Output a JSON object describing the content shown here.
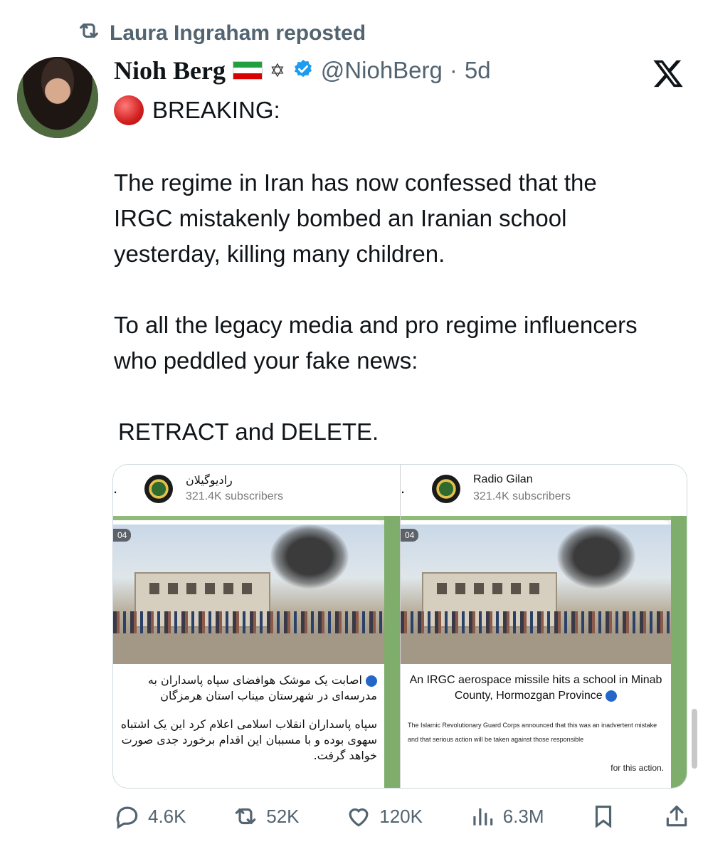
{
  "repost": {
    "text": "Laura Ingraham reposted"
  },
  "post": {
    "display_name": "Nioh Berg",
    "handle": "@NiohBerg",
    "separator": "·",
    "age": "5d",
    "breaking": "BREAKING:",
    "paragraphs": [
      "The regime in Iran has now confessed that the IRGC mistakenly bombed an Iranian school yesterday, killing many children.",
      "To all the legacy media and pro regime influencers who peddled your fake news:",
      "RETRACT and DELETE."
    ]
  },
  "media": {
    "left": {
      "channel_name": "راديوگيلان",
      "subscribers": "321.4K subscribers",
      "timer": "04",
      "caption_1": "اصابت یک موشک هوافضای سپاه پاسداران به مدرسه‌ای در شهرستان میناب استان هرمزگان",
      "caption_2": "سپاه پاسداران انقلاب اسلامی اعلام کرد این یک اشتباه سهوی بوده و با مسببان این اقدام برخورد جدی صورت خواهد گرفت."
    },
    "right": {
      "channel_name": "Radio Gilan",
      "subscribers": "321.4K subscribers",
      "timer": "04",
      "caption_1": "An IRGC aerospace missile hits a school in Minab County, Hormozgan Province",
      "caption_2a": "The Islamic Revolutionary Guard Corps announced that this was an inadvertent mistake and that serious action will be taken against those responsible",
      "caption_2b": "for this action."
    }
  },
  "actions": {
    "replies": "4.6K",
    "reposts": "52K",
    "likes": "120K",
    "views": "6.3M"
  },
  "colors": {
    "text": "#0f1419",
    "secondary": "#536471",
    "verified": "#1d9bf0",
    "telegram_green": "#7fae6c"
  },
  "icons": [
    "repost-icon",
    "verified-icon",
    "x-logo-icon",
    "reply-icon",
    "like-icon",
    "views-icon",
    "bookmark-icon",
    "share-icon"
  ]
}
